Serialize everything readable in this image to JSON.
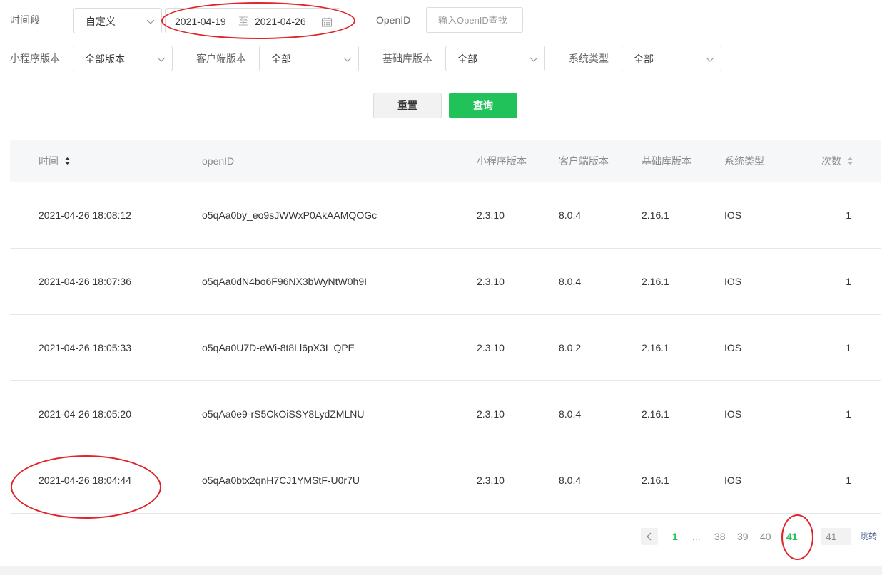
{
  "filters": {
    "time_label": "时间段",
    "time_mode": "自定义",
    "date_start": "2021-04-19",
    "date_sep": "至",
    "date_end": "2021-04-26",
    "openid_label": "OpenID",
    "openid_placeholder": "输入OpenID查找",
    "mp_version_label": "小程序版本",
    "mp_version_value": "全部版本",
    "client_version_label": "客户端版本",
    "client_version_value": "全部",
    "lib_version_label": "基础库版本",
    "lib_version_value": "全部",
    "os_label": "系统类型",
    "os_value": "全部",
    "reset_label": "重置",
    "query_label": "查询"
  },
  "table": {
    "headers": [
      "时间",
      "openID",
      "小程序版本",
      "客户端版本",
      "基础库版本",
      "系统类型",
      "次数"
    ],
    "rows": [
      [
        "2021-04-26 18:08:12",
        "o5qAa0by_eo9sJWWxP0AkAAMQOGc",
        "2.3.10",
        "8.0.4",
        "2.16.1",
        "IOS",
        "1"
      ],
      [
        "2021-04-26 18:07:36",
        "o5qAa0dN4bo6F96NX3bWyNtW0h9I",
        "2.3.10",
        "8.0.4",
        "2.16.1",
        "IOS",
        "1"
      ],
      [
        "2021-04-26 18:05:33",
        "o5qAa0U7D-eWi-8t8Ll6pX3I_QPE",
        "2.3.10",
        "8.0.2",
        "2.16.1",
        "IOS",
        "1"
      ],
      [
        "2021-04-26 18:05:20",
        "o5qAa0e9-rS5CkOiSSY8LydZMLNU",
        "2.3.10",
        "8.0.4",
        "2.16.1",
        "IOS",
        "1"
      ],
      [
        "2021-04-26 18:04:44",
        "o5qAa0btx2qnH7CJ1YMStF-U0r7U",
        "2.3.10",
        "8.0.4",
        "2.16.1",
        "IOS",
        "1"
      ]
    ]
  },
  "pagination": {
    "pages": [
      "1",
      "...",
      "38",
      "39",
      "40",
      "41"
    ],
    "current": "41",
    "jump_value": "41",
    "jump_label": "跳转"
  },
  "colors": {
    "accent": "#21c25a",
    "annotation": "#e0242a"
  }
}
